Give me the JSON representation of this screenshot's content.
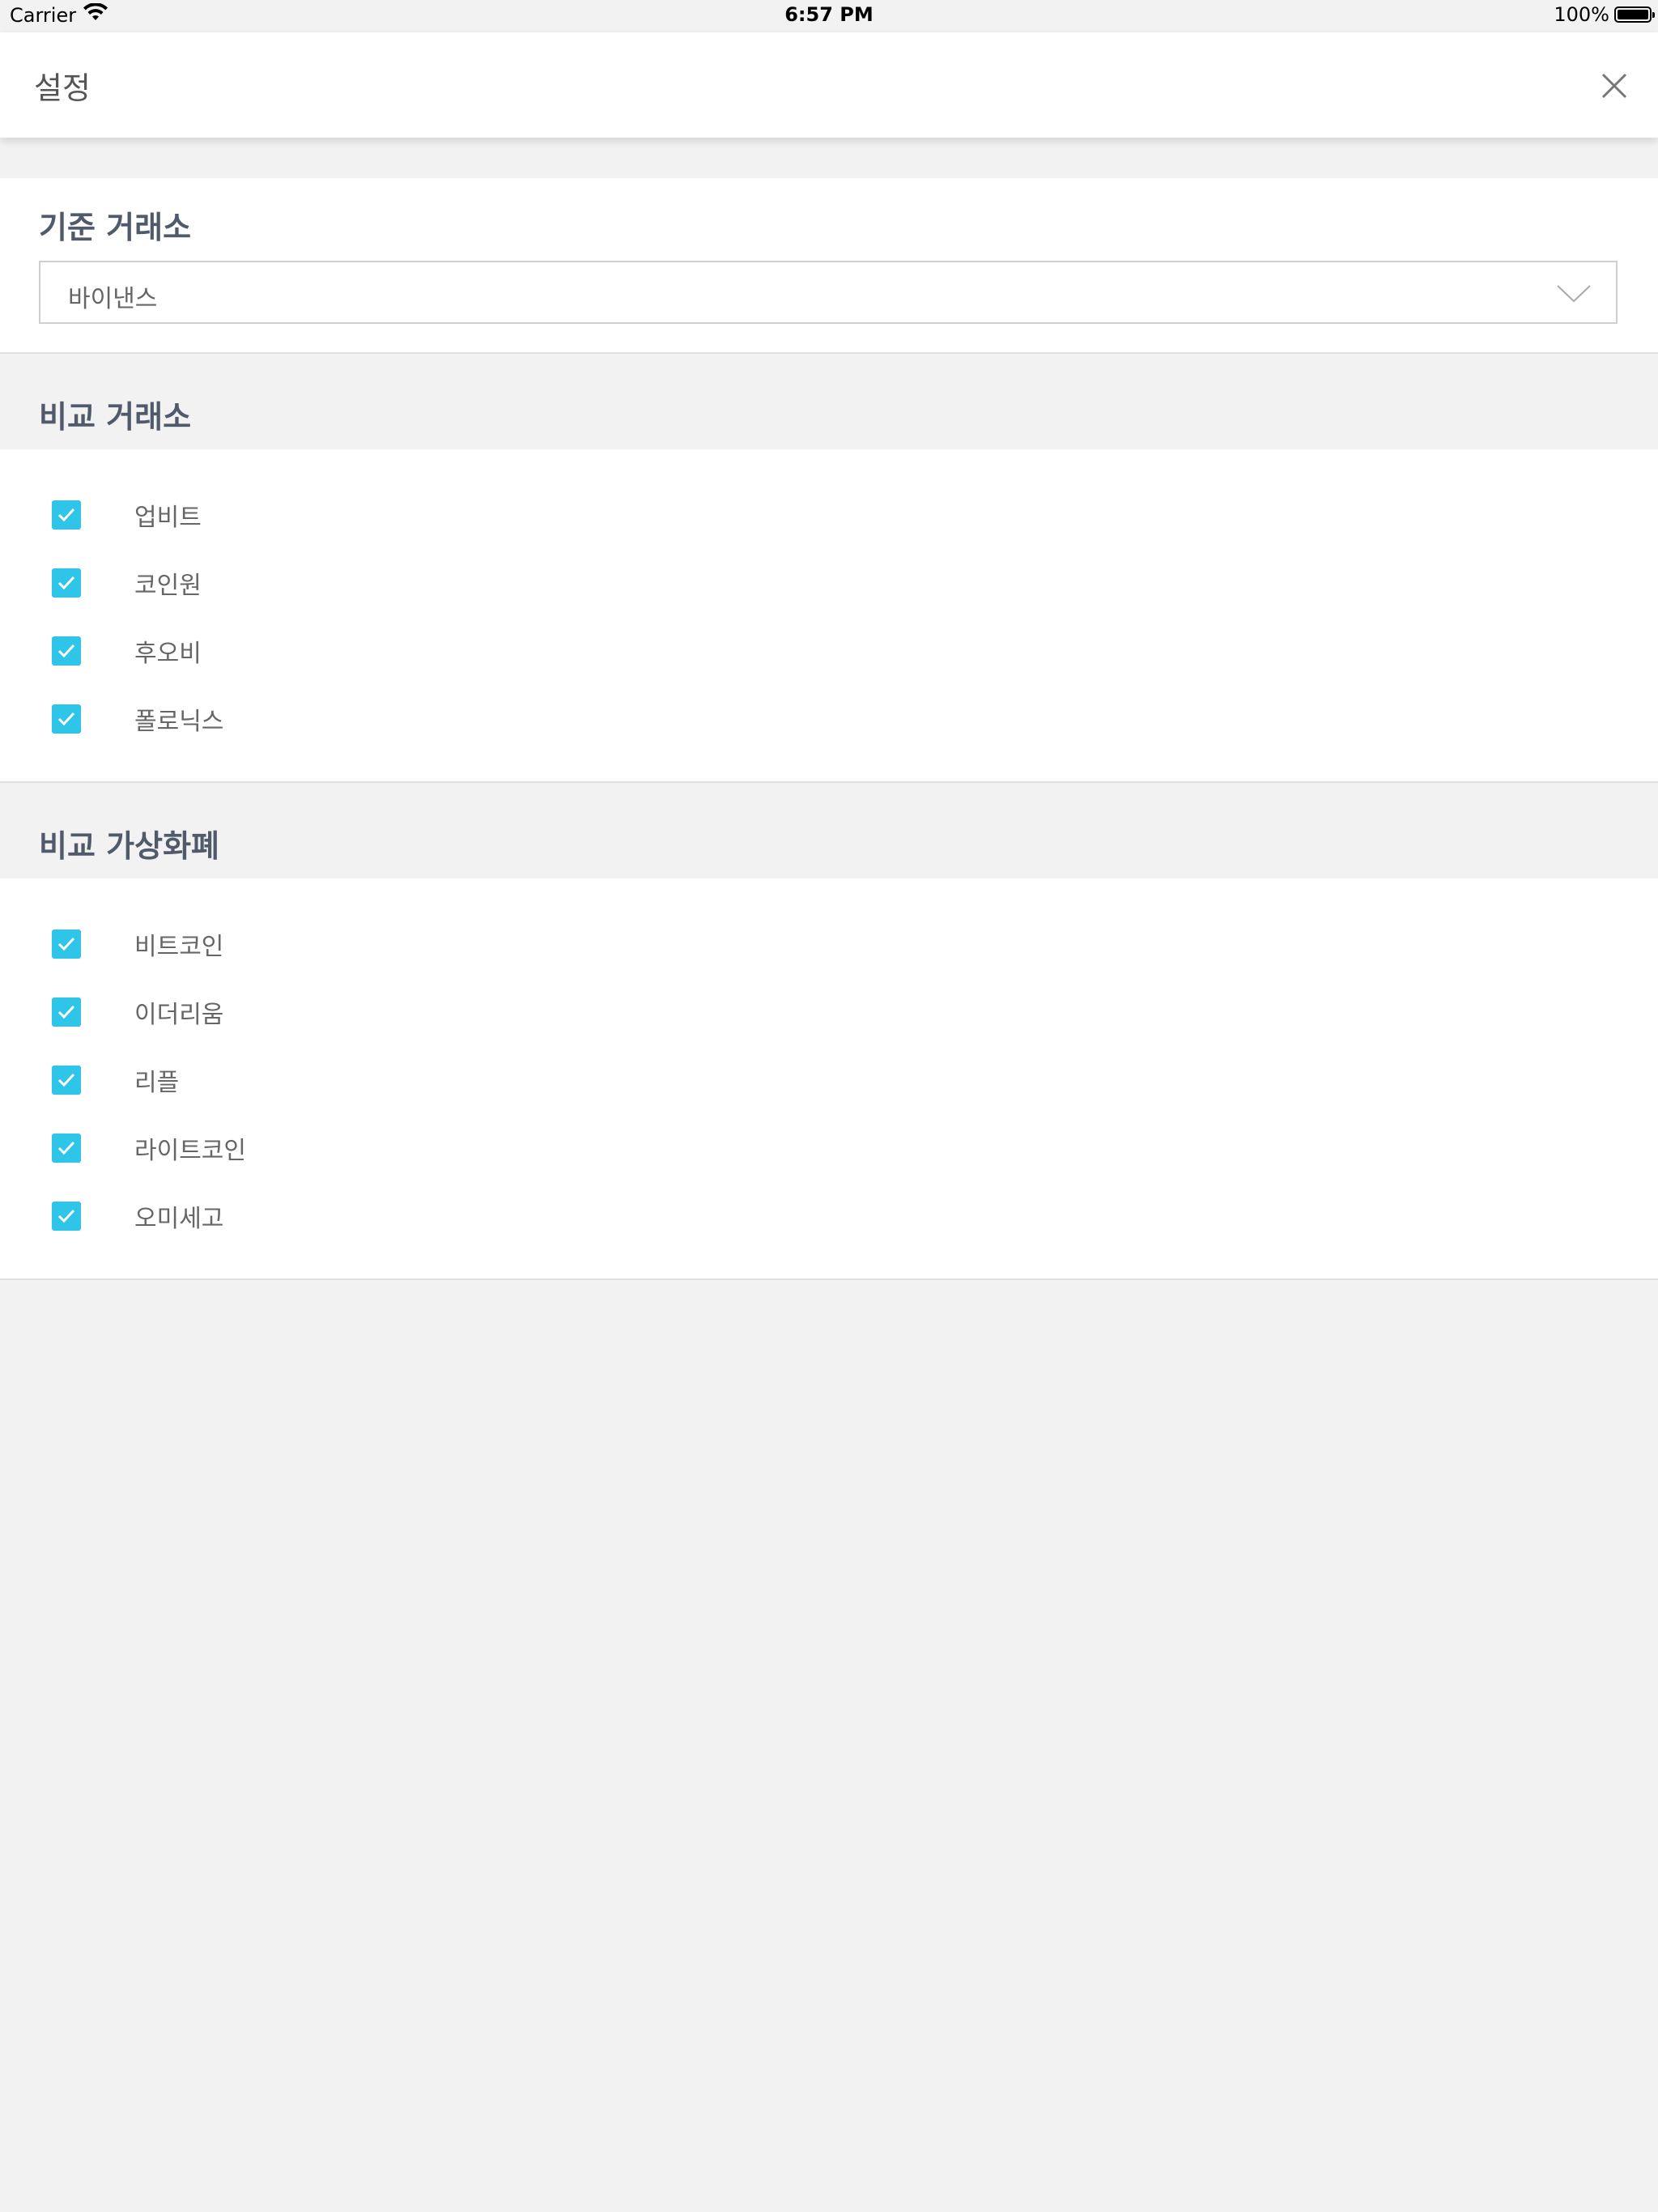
{
  "status_bar": {
    "carrier": "Carrier",
    "time": "6:57 PM",
    "battery": "100%"
  },
  "header": {
    "title": "설정",
    "close_icon": "close-icon"
  },
  "base_exchange": {
    "title": "기준 거래소",
    "selected": "바이낸스"
  },
  "compare_exchanges": {
    "title": "비교 거래소",
    "items": [
      {
        "label": "업비트",
        "checked": true
      },
      {
        "label": "코인원",
        "checked": true
      },
      {
        "label": "후오비",
        "checked": true
      },
      {
        "label": "폴로닉스",
        "checked": true
      }
    ]
  },
  "compare_coins": {
    "title": "비교 가상화폐",
    "items": [
      {
        "label": "비트코인",
        "checked": true
      },
      {
        "label": "이더리움",
        "checked": true
      },
      {
        "label": "리플",
        "checked": true
      },
      {
        "label": "라이트코인",
        "checked": true
      },
      {
        "label": "오미세고",
        "checked": true
      }
    ]
  },
  "colors": {
    "accent": "#2ec5e8",
    "background": "#f2f2f2",
    "section_title": "#505a6b"
  }
}
